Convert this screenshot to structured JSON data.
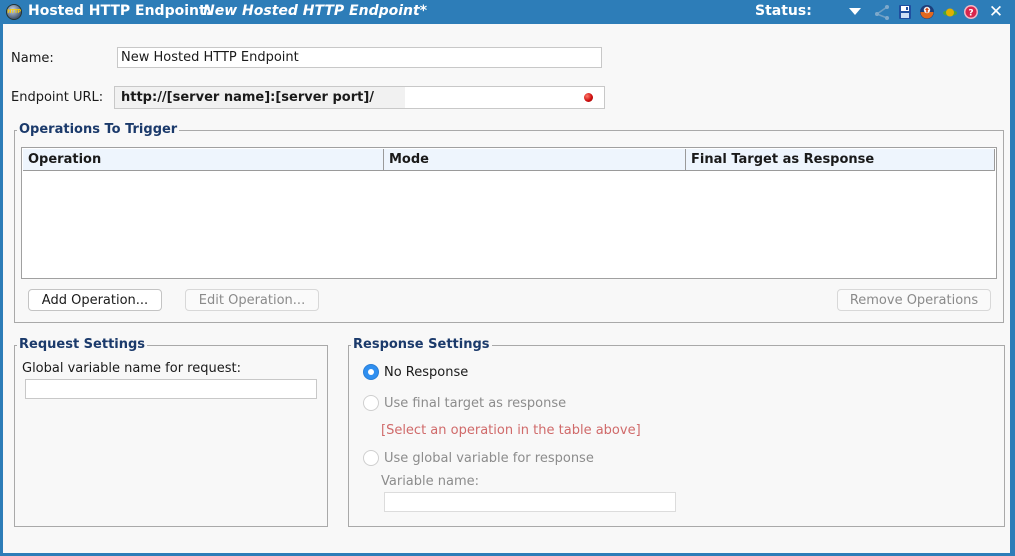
{
  "titlebar": {
    "app_icon_text": "HTTP",
    "title": "Hosted HTTP Endpoint:",
    "subtitle": "New Hosted HTTP Endpoint*",
    "status_label": "Status:",
    "icons": [
      "dropdown-arrow-icon",
      "connect-icon",
      "save-icon",
      "deploy-icon",
      "status-indicator-icon",
      "help-icon",
      "close-icon"
    ],
    "close_glyph": "✕"
  },
  "form": {
    "name_label": "Name:",
    "name_value": "New Hosted HTTP Endpoint",
    "url_label": "Endpoint URL:",
    "url_value": "http://[server name]:[server port]/",
    "url_status_color": "#d01010"
  },
  "operations": {
    "title": "Operations To Trigger",
    "columns": [
      "Operation",
      "Mode",
      "Final Target as Response"
    ],
    "rows": [],
    "buttons": {
      "add": "Add Operation...",
      "edit": "Edit Operation...",
      "remove": "Remove Operations"
    }
  },
  "request_settings": {
    "title": "Request Settings",
    "global_var_label": "Global variable name for request:",
    "global_var_value": ""
  },
  "response_settings": {
    "title": "Response Settings",
    "options": [
      {
        "label": "No Response",
        "selected": true,
        "enabled": true
      },
      {
        "label": "Use final target as response",
        "selected": false,
        "enabled": false
      },
      {
        "label": "Use global variable for response",
        "selected": false,
        "enabled": false
      }
    ],
    "hint": "[Select an operation in the table above]",
    "variable_name_label": "Variable name:",
    "variable_name_value": ""
  },
  "colors": {
    "titlebar": "#2d7db8",
    "group_title": "#1b3a6b",
    "hint": "#d06a6a",
    "radio_selected": "#2f8ff0"
  }
}
